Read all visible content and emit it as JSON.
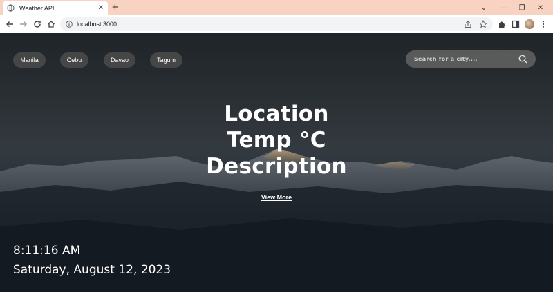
{
  "browser": {
    "tab_title": "Weather API",
    "tab_close": "✕",
    "new_tab": "+",
    "url": "localhost:3000",
    "window_controls": [
      "⌄",
      "—",
      "❐",
      "✕"
    ]
  },
  "page": {
    "cities": [
      "Manila",
      "Cebu",
      "Davao",
      "Tagum"
    ],
    "search_placeholder": "Search for a city....",
    "location": "Location",
    "temp": "Temp °C",
    "description": "Description",
    "view_more": "View More",
    "time": "8:11:16 AM",
    "date": "Saturday, August 12, 2023"
  },
  "icons": {
    "tab_favicon": "globe-icon",
    "back": "arrow-left-icon",
    "forward": "arrow-right-icon",
    "reload": "reload-icon",
    "home": "home-icon",
    "site_info": "info-icon",
    "share": "share-icon",
    "bookmark": "star-icon",
    "extensions": "puzzle-icon",
    "side_panel": "side-panel-icon",
    "profile": "avatar",
    "menu": "kebab-menu-icon",
    "search": "search-icon"
  },
  "colors": {
    "tabbar_bg": "#f8d3c2",
    "chip_bg": "#4b4b4b",
    "search_bg": "#5f5f5f",
    "text": "#ffffff"
  }
}
